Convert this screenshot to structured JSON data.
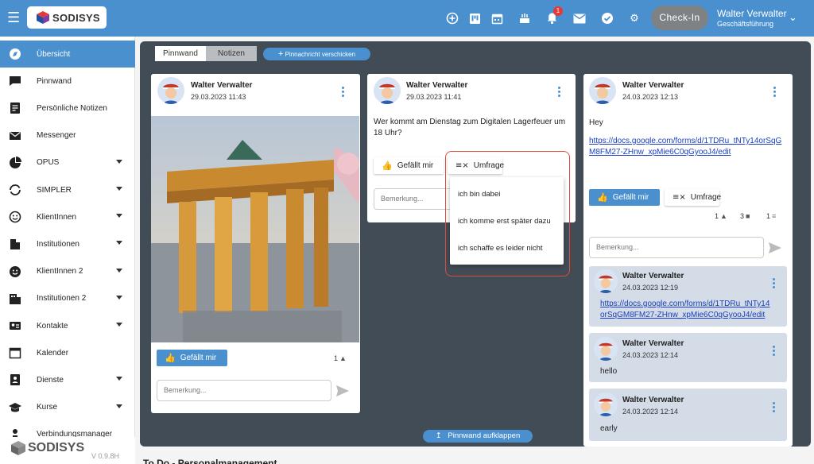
{
  "header": {
    "logo_text": "SODISYS",
    "icons": [
      "add-circle-icon",
      "kanban-icon",
      "calendar-icon",
      "cake-icon",
      "bell-icon",
      "mail-icon",
      "check-circle-icon",
      "gear-icon"
    ],
    "notification_count": "1",
    "checkin_label": "Check-In",
    "user_name": "Walter Verwalter",
    "user_role": "Geschäftsführung"
  },
  "sidebar": {
    "items": [
      {
        "label": "Übersicht",
        "icon": "compass-icon",
        "active": true,
        "expandable": false
      },
      {
        "label": "Pinnwand",
        "icon": "chat-icon",
        "expandable": false
      },
      {
        "label": "Persönliche Notizen",
        "icon": "note-icon",
        "expandable": false
      },
      {
        "label": "Messenger",
        "icon": "mail-icon",
        "expandable": false
      },
      {
        "label": "OPUS",
        "icon": "pie-icon",
        "expandable": true
      },
      {
        "label": "SIMPLER",
        "icon": "sync-icon",
        "expandable": true
      },
      {
        "label": "KlientInnen",
        "icon": "smiley-icon",
        "expandable": true
      },
      {
        "label": "Institutionen",
        "icon": "building-icon",
        "expandable": true
      },
      {
        "label": "KlientInnen 2",
        "icon": "smiley-filled-icon",
        "expandable": true
      },
      {
        "label": "Institutionen 2",
        "icon": "building2-icon",
        "expandable": true
      },
      {
        "label": "Kontakte",
        "icon": "contact-card-icon",
        "expandable": true
      },
      {
        "label": "Kalender",
        "icon": "calendar-icon",
        "expandable": false
      },
      {
        "label": "Dienste",
        "icon": "badge-icon",
        "expandable": true
      },
      {
        "label": "Kurse",
        "icon": "school-icon",
        "expandable": true
      },
      {
        "label": "Verbindungsmanager",
        "icon": "person-icon",
        "expandable": false
      }
    ],
    "footer_logo": "SODISYS",
    "version": "V 0.9.8H"
  },
  "main": {
    "tabs": [
      {
        "label": "Pinnwand",
        "active": true
      },
      {
        "label": "Notizen",
        "active": false
      }
    ],
    "send_pin_label": "Pinnachricht verschicken",
    "expand_label": "Pinnwand aufklappen"
  },
  "posts": [
    {
      "author": "Walter Verwalter",
      "date": "29.03.2023 11:43",
      "like_label": "Gefällt mir",
      "like_count": "1",
      "comment_placeholder": "Bemerkung..."
    },
    {
      "author": "Walter Verwalter",
      "date": "29.03.2023 11:41",
      "text": "Wer kommt am Dienstag zum Digitalen Lagerfeuer um 18 Uhr?",
      "like_label": "Gefällt mir",
      "poll_label": "Umfrage",
      "comment_placeholder": "Bemerkung...",
      "poll_options": [
        "ich bin dabei",
        "ich komme erst später dazu",
        "ich schaffe es leider nicht"
      ]
    },
    {
      "author": "Walter Verwalter",
      "date": "24.03.2023 12:13",
      "text": "Hey",
      "link": "https://docs.google.com/forms/d/1TDRu_tNTy14orSqGM8FM27-ZHnw_xpMie6C0qGyooJ4/edit",
      "link_line1": "https://docs.google.com/forms/d/1TDRu_tNTy14orSqG",
      "link_line2": "M8FM27-ZHnw_xpMie6C0qGyooJ4/edit",
      "like_label": "Gefällt mir",
      "poll_label": "Umfrage",
      "stats": {
        "likes": "1",
        "comments": "3",
        "poll": "1"
      },
      "comment_placeholder": "Bemerkung...",
      "comments": [
        {
          "author": "Walter Verwalter",
          "date": "24.03.2023 12:19",
          "link_line1": "https://docs.google.com/forms/d/1TDRu_tNTy14",
          "link_line2": "orSqGM8FM27-ZHnw_xpMie6C0qGyooJ4/edit"
        },
        {
          "author": "Walter Verwalter",
          "date": "24.03.2023 12:14",
          "text": "hello"
        },
        {
          "author": "Walter Verwalter",
          "date": "24.03.2023 12:14",
          "text": "early"
        }
      ]
    }
  ],
  "below": {
    "title": "To Do - Personalmanagement"
  },
  "colors": {
    "primary": "#4a90cf",
    "dark_panel": "#424c57",
    "highlight": "#e04a3a"
  }
}
